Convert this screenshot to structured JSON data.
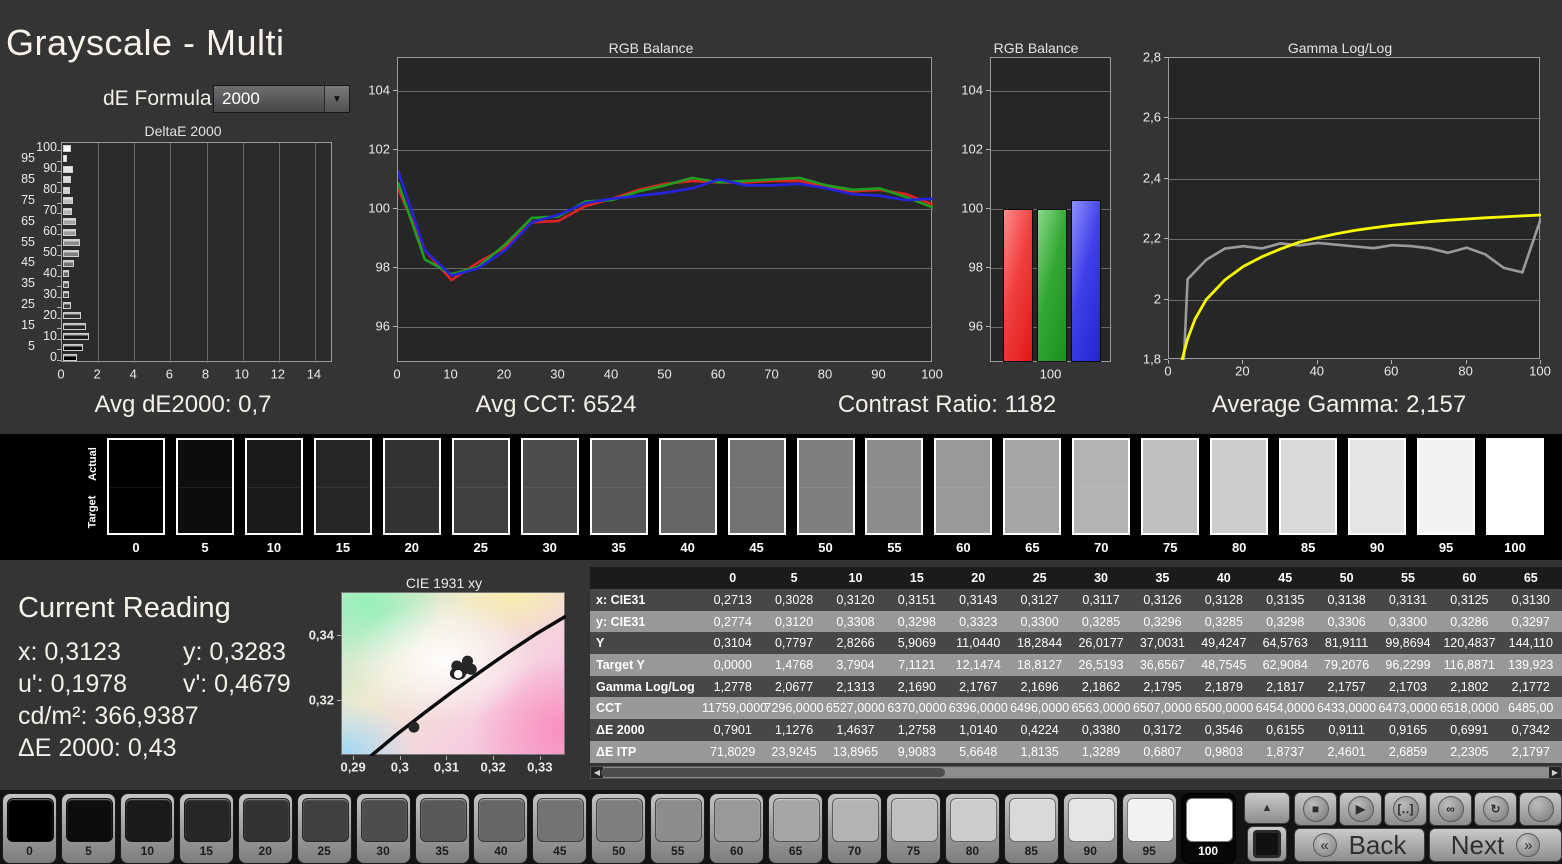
{
  "header": {
    "title": "Grayscale - Multi",
    "de_formula_label": "dE Formula:",
    "de_formula_value": "2000"
  },
  "stats": {
    "avg_de": "Avg dE2000: 0,7",
    "avg_cct": "Avg CCT: 6524",
    "contrast": "Contrast Ratio: 1182",
    "avg_gamma": "Average Gamma: 2,157"
  },
  "colors": {
    "red": "#e12222",
    "green": "#1f9e1f",
    "blue": "#2424dd",
    "yellow": "#f8f800",
    "gray_curve": "#9a9a9a"
  },
  "swatch_strip": {
    "actual_label": "Actual",
    "target_label": "Target",
    "levels": [
      0,
      5,
      10,
      15,
      20,
      25,
      30,
      35,
      40,
      45,
      50,
      55,
      60,
      65,
      70,
      75,
      80,
      85,
      90,
      95,
      100
    ]
  },
  "current_reading": {
    "title": "Current Reading",
    "row1_left": "x: 0,3123",
    "row1_right": "y: 0,3283",
    "row2_left": "u': 0,1978",
    "row2_right": "v': 0,4679",
    "row3": "cd/m²: 366,9387",
    "row4": "ΔE 2000: 0,43"
  },
  "table": {
    "col_headers": [
      "0",
      "5",
      "10",
      "15",
      "20",
      "25",
      "30",
      "35",
      "40",
      "45",
      "50",
      "55",
      "60",
      "65"
    ],
    "rows": [
      {
        "label": "x: CIE31",
        "values": [
          "0,2713",
          "0,3028",
          "0,3120",
          "0,3151",
          "0,3143",
          "0,3127",
          "0,3117",
          "0,3126",
          "0,3128",
          "0,3135",
          "0,3138",
          "0,3131",
          "0,3125",
          "0,3130"
        ]
      },
      {
        "label": "y: CIE31",
        "values": [
          "0,2774",
          "0,3120",
          "0,3308",
          "0,3298",
          "0,3323",
          "0,3300",
          "0,3285",
          "0,3296",
          "0,3285",
          "0,3298",
          "0,3306",
          "0,3300",
          "0,3286",
          "0,3297"
        ]
      },
      {
        "label": "Y",
        "values": [
          "0,3104",
          "0,7797",
          "2,8266",
          "5,9069",
          "11,0440",
          "18,2844",
          "26,0177",
          "37,0031",
          "49,4247",
          "64,5763",
          "81,9111",
          "99,8694",
          "120,4837",
          "144,110"
        ]
      },
      {
        "label": "Target Y",
        "values": [
          "0,0000",
          "1,4768",
          "3,7904",
          "7,1121",
          "12,1474",
          "18,8127",
          "26,5193",
          "36,6567",
          "48,7545",
          "62,9084",
          "79,2076",
          "96,2299",
          "116,8871",
          "139,923"
        ]
      },
      {
        "label": "Gamma Log/Log",
        "values": [
          "1,2778",
          "2,0677",
          "2,1313",
          "2,1690",
          "2,1767",
          "2,1696",
          "2,1862",
          "2,1795",
          "2,1879",
          "2,1817",
          "2,1757",
          "2,1703",
          "2,1802",
          "2,1772"
        ]
      },
      {
        "label": "CCT",
        "values": [
          "11759,0000",
          "7296,0000",
          "6527,0000",
          "6370,0000",
          "6396,0000",
          "6496,0000",
          "6563,0000",
          "6507,0000",
          "6500,0000",
          "6454,0000",
          "6433,0000",
          "6473,0000",
          "6518,0000",
          "6485,00"
        ]
      },
      {
        "label": "ΔE 2000",
        "values": [
          "0,7901",
          "1,1276",
          "1,4637",
          "1,2758",
          "1,0140",
          "0,4224",
          "0,3380",
          "0,3172",
          "0,3546",
          "0,6155",
          "0,9111",
          "0,9165",
          "0,6991",
          "0,7342"
        ]
      },
      {
        "label": "ΔE ITP",
        "values": [
          "71,8029",
          "23,9245",
          "13,8965",
          "9,9083",
          "5,6648",
          "1,8135",
          "1,3289",
          "0,6807",
          "0,9803",
          "1,8737",
          "2,4601",
          "2,6859",
          "2,2305",
          "2,1797"
        ]
      }
    ]
  },
  "toolbar": {
    "levels": [
      0,
      5,
      10,
      15,
      20,
      25,
      30,
      35,
      40,
      45,
      50,
      55,
      60,
      65,
      70,
      75,
      80,
      85,
      90,
      95,
      100
    ],
    "selected": 100,
    "up_glyph": "▲",
    "square_glyph": "■",
    "controls": [
      {
        "name": "stop-button",
        "glyph": "■"
      },
      {
        "name": "play-button",
        "glyph": "▶"
      },
      {
        "name": "loop-section-button",
        "glyph": "[‥]"
      },
      {
        "name": "infinite-loop-button",
        "glyph": "∞"
      },
      {
        "name": "refresh-button",
        "glyph": "↻"
      },
      {
        "name": "record-button",
        "glyph": ""
      }
    ],
    "back_label": "Back",
    "next_label": "Next",
    "back_arrow": "«",
    "next_arrow": "»"
  },
  "chart_data": [
    {
      "id": "deltae",
      "type": "bar",
      "orientation": "horizontal",
      "title": "DeltaE 2000",
      "categories": [
        0,
        5,
        10,
        15,
        20,
        25,
        30,
        35,
        40,
        45,
        50,
        55,
        60,
        65,
        70,
        75,
        80,
        85,
        90,
        95,
        100
      ],
      "values": [
        0.79,
        1.13,
        1.46,
        1.28,
        1.01,
        0.42,
        0.34,
        0.32,
        0.35,
        0.62,
        0.91,
        0.92,
        0.7,
        0.73,
        0.52,
        0.55,
        0.38,
        0.45,
        0.55,
        0.22,
        0.45
      ],
      "xlim": [
        0,
        15
      ],
      "xticks": [
        0,
        2,
        4,
        6,
        8,
        10,
        12,
        14
      ],
      "grid": "vertical"
    },
    {
      "id": "rgb_balance_line",
      "type": "line",
      "title": "RGB Balance",
      "x": [
        0,
        5,
        10,
        15,
        20,
        25,
        30,
        35,
        40,
        45,
        50,
        55,
        60,
        65,
        70,
        75,
        80,
        85,
        90,
        95,
        100
      ],
      "ylim": [
        94.8,
        105.1
      ],
      "yticks": [
        96,
        98,
        100,
        102,
        104
      ],
      "xticks": [
        0,
        10,
        20,
        30,
        40,
        50,
        60,
        70,
        80,
        90,
        100
      ],
      "series": [
        {
          "name": "red",
          "values": [
            100.7,
            98.6,
            97.6,
            98.2,
            98.7,
            99.55,
            99.6,
            100.1,
            100.35,
            100.65,
            100.85,
            100.95,
            100.9,
            100.9,
            100.95,
            100.95,
            100.75,
            100.6,
            100.65,
            100.5,
            100.15
          ]
        },
        {
          "name": "green",
          "values": [
            100.9,
            98.3,
            97.8,
            98.05,
            98.8,
            99.7,
            99.75,
            100.25,
            100.3,
            100.6,
            100.8,
            101.05,
            100.9,
            100.95,
            101.0,
            101.05,
            100.8,
            100.65,
            100.7,
            100.4,
            100.05
          ]
        },
        {
          "name": "blue",
          "values": [
            101.3,
            98.6,
            97.75,
            98.0,
            98.6,
            99.55,
            99.8,
            100.2,
            100.35,
            100.45,
            100.55,
            100.7,
            101.0,
            100.8,
            100.8,
            100.85,
            100.7,
            100.5,
            100.45,
            100.3,
            100.35
          ]
        }
      ]
    },
    {
      "id": "rgb_balance_bar",
      "type": "bar",
      "title": "RGB Balance",
      "categories": [
        "100"
      ],
      "ylim": [
        94.8,
        105.1
      ],
      "yticks": [
        96,
        98,
        100,
        102,
        104
      ],
      "series": [
        {
          "name": "red",
          "values": [
            100.0
          ]
        },
        {
          "name": "green",
          "values": [
            100.0
          ]
        },
        {
          "name": "blue",
          "values": [
            100.32
          ]
        }
      ]
    },
    {
      "id": "gamma",
      "type": "line",
      "title": "Gamma Log/Log",
      "ylim": [
        1.8,
        2.8
      ],
      "yticks": [
        1.8,
        2.0,
        2.2,
        2.4,
        2.6,
        2.8
      ],
      "ytick_labels": [
        "1,8",
        "2",
        "2,2",
        "2,4",
        "2,6",
        "2,8"
      ],
      "xticks": [
        0,
        20,
        40,
        60,
        80,
        100
      ],
      "series": [
        {
          "name": "target",
          "x": [
            3.5,
            5,
            7,
            10,
            15,
            20,
            25,
            30,
            35,
            40,
            45,
            50,
            55,
            60,
            65,
            70,
            75,
            80,
            85,
            90,
            95,
            100
          ],
          "values": [
            1.8,
            1.87,
            1.935,
            2.0,
            2.065,
            2.11,
            2.142,
            2.168,
            2.19,
            2.205,
            2.218,
            2.229,
            2.238,
            2.246,
            2.252,
            2.258,
            2.263,
            2.267,
            2.271,
            2.274,
            2.277,
            2.28
          ]
        },
        {
          "name": "measured",
          "x": [
            4,
            5,
            10,
            15,
            20,
            25,
            30,
            35,
            40,
            45,
            50,
            55,
            60,
            65,
            70,
            75,
            80,
            85,
            90,
            95,
            100
          ],
          "values": [
            1.8,
            2.0677,
            2.1313,
            2.169,
            2.1767,
            2.1696,
            2.1862,
            2.1795,
            2.1879,
            2.1817,
            2.1757,
            2.1703,
            2.1802,
            2.1772,
            2.17,
            2.155,
            2.172,
            2.15,
            2.105,
            2.09,
            2.27
          ]
        }
      ]
    },
    {
      "id": "cie",
      "type": "scatter",
      "title": "CIE 1931 xy",
      "xlim": [
        0.2874,
        0.3354
      ],
      "ylim": [
        0.3031,
        0.3533
      ],
      "xticks": [
        0.29,
        0.3,
        0.31,
        0.32,
        0.33
      ],
      "xtick_labels": [
        "0,29",
        "0,3",
        "0,31",
        "0,32",
        "0,33"
      ],
      "yticks": [
        0.32,
        0.34
      ],
      "ytick_labels": [
        "0,32",
        "0,34"
      ],
      "locus": [
        [
          0.2936,
          0.3031
        ],
        [
          0.299,
          0.3096
        ],
        [
          0.305,
          0.3163
        ],
        [
          0.311,
          0.3228
        ],
        [
          0.317,
          0.329
        ],
        [
          0.323,
          0.335
        ],
        [
          0.329,
          0.3407
        ],
        [
          0.3354,
          0.3462
        ]
      ],
      "points": [
        [
          0.3028,
          0.312
        ],
        [
          0.312,
          0.3308
        ],
        [
          0.3151,
          0.3298
        ],
        [
          0.3143,
          0.3323
        ],
        [
          0.3127,
          0.33
        ],
        [
          0.3117,
          0.3285
        ],
        [
          0.3126,
          0.3296
        ],
        [
          0.3128,
          0.3285
        ],
        [
          0.3135,
          0.3298
        ],
        [
          0.3138,
          0.3306
        ],
        [
          0.3131,
          0.33
        ],
        [
          0.3125,
          0.3286
        ],
        [
          0.313,
          0.3297
        ]
      ],
      "current": [
        0.3123,
        0.3283
      ]
    }
  ]
}
